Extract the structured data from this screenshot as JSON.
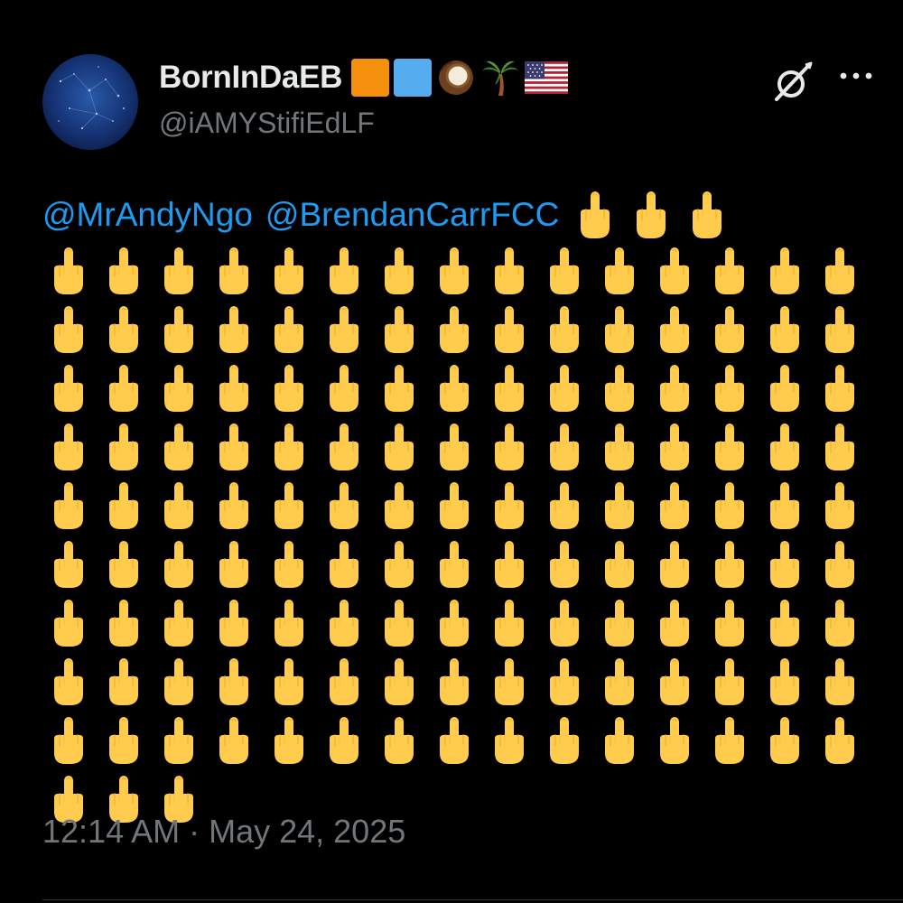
{
  "author": {
    "display_name": "BornInDaEB",
    "handle": "@iAMYStifiEdLF",
    "name_emojis": [
      "orange-square",
      "blue-square",
      "coconut",
      "palm-tree",
      "us-flag"
    ]
  },
  "header_actions": {
    "grok_icon": "grok-icon",
    "more_icon": "more-icon"
  },
  "tweet": {
    "mentions": [
      "@MrAndyNgo",
      "@BrendanCarrFCC"
    ],
    "emoji": "🖕",
    "emoji_count_first_line": 3,
    "emoji_count_grid": 138
  },
  "timestamp": "12:14 AM · May 24, 2025",
  "colors": {
    "background": "#000000",
    "primary_text": "#e7e9ea",
    "secondary_text": "#71767b",
    "link": "#1d9bf0",
    "emoji_yellow": "#ffcc4d"
  }
}
